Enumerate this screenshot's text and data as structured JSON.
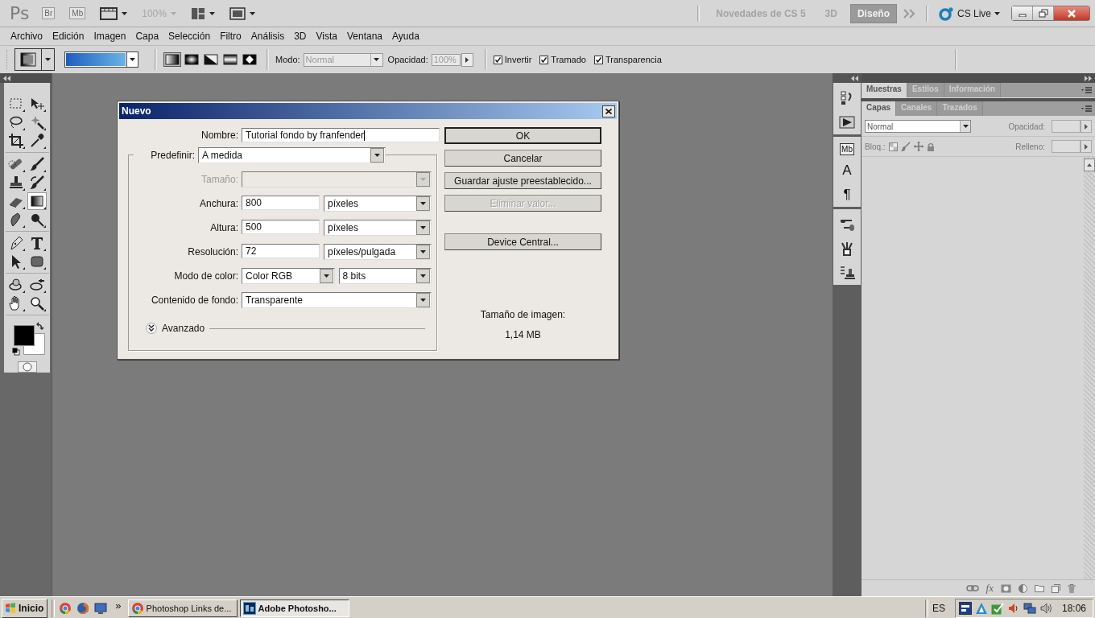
{
  "app_bar": {
    "logo": "Ps",
    "bridge": "Br",
    "mini_bridge": "Mb",
    "zoom": "100%",
    "workspaces": [
      {
        "label": "Novedades de CS 5",
        "selected": false
      },
      {
        "label": "3D",
        "selected": false
      },
      {
        "label": "Diseño",
        "selected": true
      }
    ],
    "cs_live": "CS Live"
  },
  "menu": [
    "Archivo",
    "Edición",
    "Imagen",
    "Capa",
    "Selección",
    "Filtro",
    "Análisis",
    "3D",
    "Vista",
    "Ventana",
    "Ayuda"
  ],
  "options_bar": {
    "gradient_types": [
      {
        "kind": "linear",
        "selected": true
      },
      {
        "kind": "radial",
        "selected": false
      },
      {
        "kind": "angle",
        "selected": false
      },
      {
        "kind": "reflected",
        "selected": false
      },
      {
        "kind": "diamond",
        "selected": false
      }
    ],
    "mode_label": "Modo:",
    "mode": "Normal",
    "opacity_label": "Opacidad:",
    "opacity": "100%",
    "checkboxes": [
      {
        "label": "Invertir",
        "checked": true
      },
      {
        "label": "Tramado",
        "checked": true
      },
      {
        "label": "Transparencia",
        "checked": true
      }
    ]
  },
  "tool_groups": [
    {
      "tools": [
        {
          "kind": "marquee",
          "selected": false
        },
        {
          "kind": "move",
          "selected": false
        },
        {
          "kind": "lasso",
          "selected": false
        },
        {
          "kind": "wand",
          "selected": false
        },
        {
          "kind": "crop",
          "selected": false
        },
        {
          "kind": "eyedropper",
          "selected": false
        }
      ]
    },
    {
      "tools": [
        {
          "kind": "heal",
          "selected": false
        },
        {
          "kind": "brush",
          "selected": false
        },
        {
          "kind": "stamp",
          "selected": false
        },
        {
          "kind": "historybrush",
          "selected": false
        },
        {
          "kind": "eraser",
          "selected": false
        },
        {
          "kind": "gradient",
          "selected": true
        },
        {
          "kind": "smudge",
          "selected": false
        },
        {
          "kind": "dodge",
          "selected": false
        }
      ]
    },
    {
      "tools": [
        {
          "kind": "pen",
          "selected": false
        },
        {
          "kind": "type",
          "selected": false
        },
        {
          "kind": "pathselect",
          "selected": false
        },
        {
          "kind": "shape",
          "selected": false
        }
      ]
    },
    {
      "tools": [
        {
          "kind": "rotate3d",
          "selected": false
        },
        {
          "kind": "orbit3d",
          "selected": false
        },
        {
          "kind": "hand",
          "selected": false
        },
        {
          "kind": "zoom",
          "selected": false
        }
      ]
    }
  ],
  "dialog": {
    "title": "Nuevo",
    "name_label": "Nombre:",
    "name": "Tutorial fondo by franfender",
    "preset_label": "Predefinir:",
    "preset": "A medida",
    "rows": [
      {
        "label": "Tamaño:",
        "disabled": true,
        "fields": [
          {
            "kind": "select"
          }
        ]
      },
      {
        "label": "Anchura:",
        "disabled": false,
        "fields": [
          {
            "kind": "input",
            "value": "800"
          },
          {
            "kind": "select",
            "value": "píxeles"
          }
        ]
      },
      {
        "label": "Altura:",
        "disabled": false,
        "fields": [
          {
            "kind": "input",
            "value": "500"
          },
          {
            "kind": "select",
            "value": "píxeles"
          }
        ]
      },
      {
        "label": "Resolución:",
        "disabled": false,
        "fields": [
          {
            "kind": "input",
            "value": "72"
          },
          {
            "kind": "select",
            "value": "píxeles/pulgada"
          }
        ]
      },
      {
        "label": "Modo de color:",
        "disabled": false,
        "fields": [
          {
            "kind": "select",
            "value": "Color RGB"
          },
          {
            "kind": "select",
            "value": "8 bits"
          }
        ]
      },
      {
        "label": "Contenido de fondo:",
        "disabled": false,
        "fields": [
          {
            "kind": "select",
            "value": "Transparente"
          }
        ]
      }
    ],
    "advanced": {
      "label": "Avanzado",
      "expanded": false
    },
    "buttons": [
      {
        "label": "OK",
        "default": true,
        "disabled": false
      },
      {
        "label": "Cancelar",
        "default": false,
        "disabled": false
      },
      {
        "label": "Guardar ajuste preestablecido...",
        "default": false,
        "disabled": false
      },
      {
        "label": "Eliminar valor...",
        "default": false,
        "disabled": true
      }
    ],
    "device_button": "Device Central...",
    "image_size_label": "Tamaño de imagen:",
    "image_size": "1,14 MB"
  },
  "dock_groups": [
    {
      "items": [
        {
          "kind": "history"
        },
        {
          "kind": "actions"
        }
      ]
    },
    {
      "items": [
        {
          "kind": "glyph",
          "glyph": "Mb"
        },
        {
          "kind": "glyph",
          "glyph": "A"
        },
        {
          "kind": "glyph",
          "glyph": "¶"
        }
      ]
    },
    {
      "items": [
        {
          "kind": "brushes"
        },
        {
          "kind": "clone"
        },
        {
          "kind": "presets"
        }
      ]
    }
  ],
  "panels": [
    {
      "tabs": [
        {
          "label": "Muestras",
          "selected": true
        },
        {
          "label": "Estilos",
          "selected": false
        },
        {
          "label": "Información",
          "selected": false
        }
      ]
    },
    {
      "tabs": [
        {
          "label": "Capas",
          "selected": true
        },
        {
          "label": "Canales",
          "selected": false
        },
        {
          "label": "Trazados",
          "selected": false
        }
      ]
    }
  ],
  "layers": {
    "blend_mode": "Normal",
    "opacity_label": "Opacidad:",
    "lock_label": "Bloq.:",
    "fill_label": "Relleno:",
    "effects": "fx"
  },
  "taskbar": {
    "start": "Inicio",
    "more": "»",
    "tasks": [
      {
        "kind": "browser",
        "label": "Photoshop Links de...",
        "selected": false
      },
      {
        "kind": "photoshop",
        "label": "Adobe Photosho...",
        "selected": true
      }
    ],
    "language": "ES",
    "clock": "18:06"
  }
}
